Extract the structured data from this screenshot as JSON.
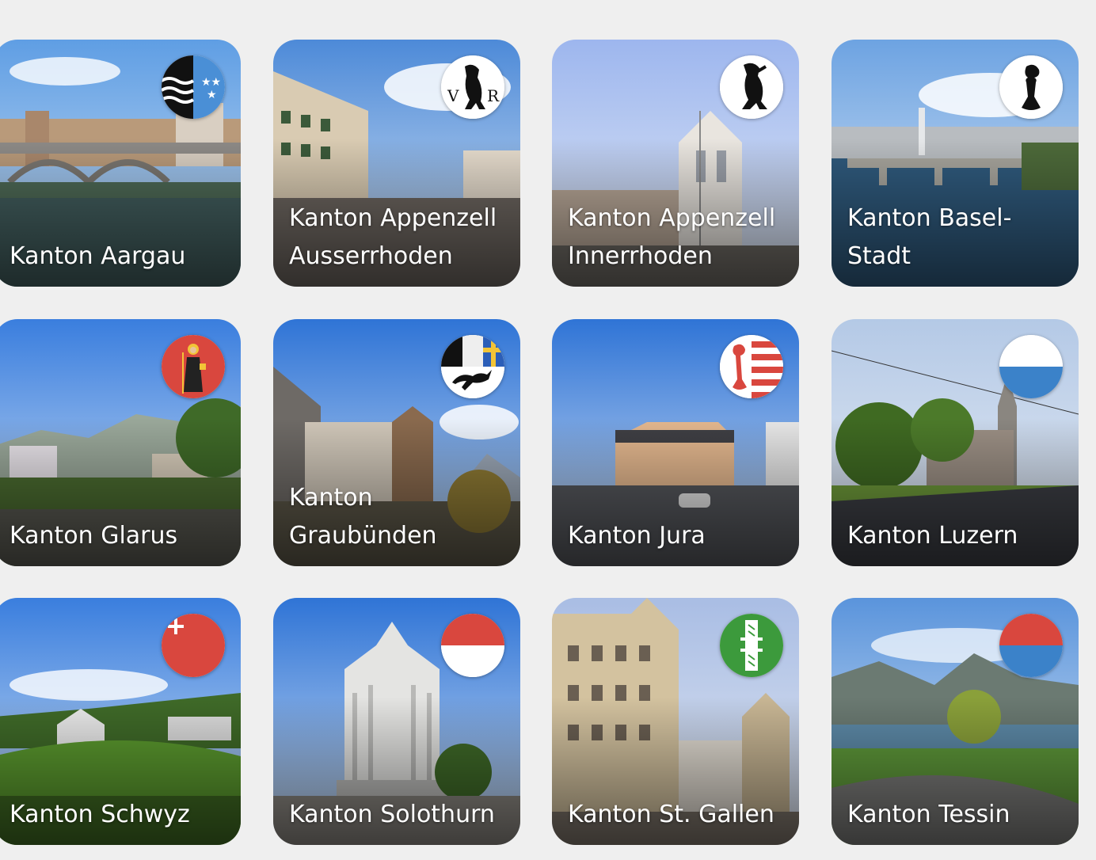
{
  "cantons": [
    {
      "name": "Kanton Aargau",
      "flag_icon": "aargau-flag-icon",
      "sky": "#7fb3e6",
      "ground": "#4d6b4a"
    },
    {
      "name": "Kanton Appenzell Ausserrhoden",
      "flag_icon": "appenzell-ausserrhoden-flag-icon",
      "sky": "#6ea3dc",
      "ground": "#6a6560"
    },
    {
      "name": "Kanton Appenzell Innerrhoden",
      "flag_icon": "appenzell-innerrhoden-flag-icon",
      "sky": "#b6c8f0",
      "ground": "#6e6a64"
    },
    {
      "name": "Kanton Basel-Stadt",
      "flag_icon": "basel-stadt-flag-icon",
      "sky": "#86b4e8",
      "ground": "#2c4e6e"
    },
    {
      "name": "Kanton Glarus",
      "flag_icon": "glarus-flag-icon",
      "sky": "#4e8de0",
      "ground": "#4a6b32"
    },
    {
      "name": "Kanton Graubünden",
      "flag_icon": "graubuenden-flag-icon",
      "sky": "#3d7fd6",
      "ground": "#5a5448"
    },
    {
      "name": "Kanton Jura",
      "flag_icon": "jura-flag-icon",
      "sky": "#3f86df",
      "ground": "#55575c"
    },
    {
      "name": "Kanton Luzern",
      "flag_icon": "luzern-flag-icon",
      "sky": "#c9d8ec",
      "ground": "#3c3e44"
    },
    {
      "name": "Kanton Schwyz",
      "flag_icon": "schwyz-flag-icon",
      "sky": "#4a8ee4",
      "ground": "#4f8a2c"
    },
    {
      "name": "Kanton Solothurn",
      "flag_icon": "solothurn-flag-icon",
      "sky": "#3b82e0",
      "ground": "#8a8680"
    },
    {
      "name": "Kanton St. Gallen",
      "flag_icon": "st-gallen-flag-icon",
      "sky": "#b7c8e6",
      "ground": "#7d746a"
    },
    {
      "name": "Kanton Tessin",
      "flag_icon": "tessin-flag-icon",
      "sky": "#6ea2de",
      "ground": "#5f9a3a"
    }
  ]
}
